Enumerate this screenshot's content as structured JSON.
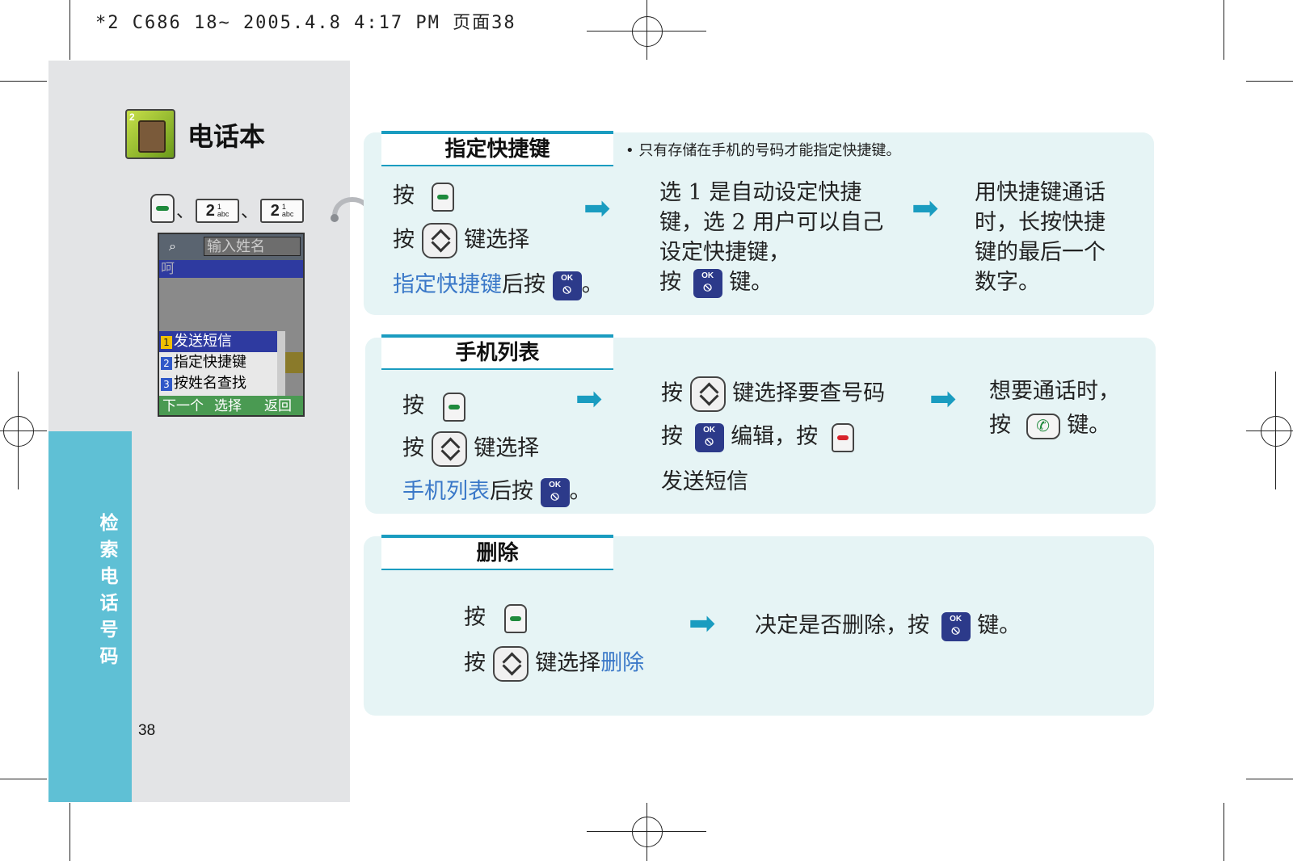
{
  "print_header": "*2 C686 18~ 2005.4.8 4:17 PM 页面38",
  "sidebar": {
    "app_title": "电话本",
    "app_icon_number": "2",
    "key_separator": "、",
    "keys": [
      {
        "type": "soft-key-green"
      },
      {
        "type": "number-key",
        "label": "2",
        "sub1": "1",
        "sub2": "abc"
      },
      {
        "type": "number-key",
        "label": "2",
        "sub1": "1",
        "sub2": "abc"
      }
    ],
    "section_label": "检索电话号码",
    "page_number": "38"
  },
  "phone_screen": {
    "search_placeholder": "输入姓名",
    "selected_row": "呵",
    "menu": [
      {
        "num": "1",
        "label": "发送短信",
        "active": true
      },
      {
        "num": "2",
        "label": "指定快捷键",
        "active": false
      },
      {
        "num": "3",
        "label": "按姓名查找",
        "active": false
      }
    ],
    "softkeys": {
      "left": "下一个",
      "center": "选择",
      "right": "返回"
    }
  },
  "panels": {
    "speed_dial": {
      "title": "指定快捷键",
      "note": "• 只有存储在手机的号码才能指定快捷键。",
      "press": "按",
      "step1_key_suffix": "键选择",
      "link_text": "指定快捷键",
      "after_press": "后按",
      "period": "。",
      "col2": "选 1 是自动设定快捷键，选 2 用户可以自己设定快捷键，",
      "col2_press": "按",
      "col2_key_suffix": "键。",
      "col3": "用快捷键通话时，长按快捷键的最后一个数字。"
    },
    "phone_list": {
      "title": "手机列表",
      "press": "按",
      "step1_key_suffix": "键选择",
      "link_text": "手机列表",
      "after_press": "后按",
      "period": "。",
      "col2_line1": "键选择要查号码",
      "col2_line2_a": "编辑，按",
      "col2_line3": "发送短信",
      "col3_line1": "想要通话时，",
      "col3_press": "按",
      "col3_suffix": "键。"
    },
    "delete": {
      "title": "删除",
      "press": "按",
      "key_select": "键选择",
      "link_text": "删除",
      "col2_text": "决定是否删除，按",
      "col2_suffix": "键。"
    }
  },
  "icons": {
    "ok_label": "OK",
    "arrow": "➡"
  },
  "colors": {
    "accent_blue": "#1a9cc0",
    "side_tab": "#5fc0d5",
    "panel_bg": "#e6f4f5",
    "link": "#3a78c8"
  }
}
